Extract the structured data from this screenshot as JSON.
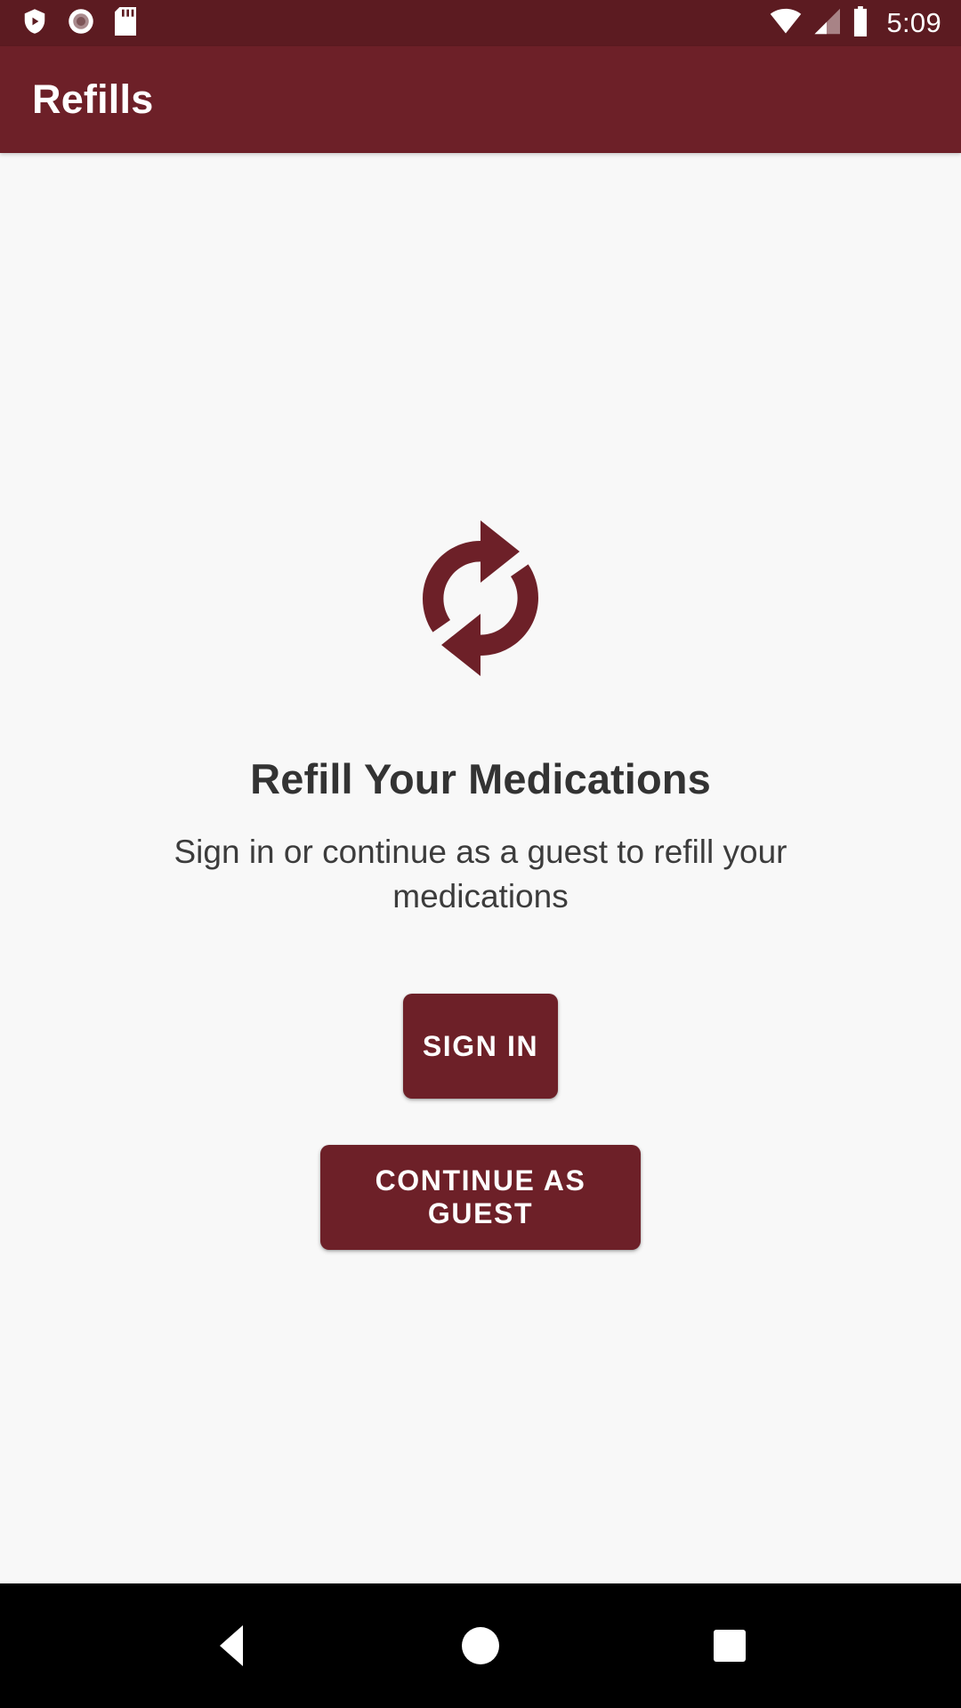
{
  "status_bar": {
    "time": "5:09",
    "left_icons": [
      {
        "name": "play-protect-shield-icon",
        "glyph": "shield-play"
      },
      {
        "name": "record-circle-icon",
        "glyph": "record"
      },
      {
        "name": "sd-card-icon",
        "glyph": "sdcard"
      }
    ],
    "right_icons": [
      {
        "name": "wifi-icon",
        "glyph": "wifi-full"
      },
      {
        "name": "cellular-signal-icon",
        "glyph": "signal-partial"
      },
      {
        "name": "battery-icon",
        "glyph": "battery-full"
      }
    ],
    "background_color": "#5C1B21",
    "foreground_color": "#FFFFFF"
  },
  "app_bar": {
    "title": "Refills",
    "background_color": "#6D2028",
    "title_color": "#FFFFFF"
  },
  "main": {
    "hero_icon_name": "refresh-sync-icon",
    "hero_icon_color": "#6D2028",
    "headline": "Refill Your Medications",
    "subhead": "Sign in or continue as a guest to refill your medications",
    "background_color": "#F8F8F8",
    "headline_color": "#333333",
    "subhead_color": "#3C3C3C",
    "buttons": {
      "sign_in_label": "SIGN IN",
      "continue_guest_label": "CONTINUE AS GUEST",
      "button_color": "#6D2028",
      "button_text_color": "#FFFFFF"
    }
  },
  "nav_bar": {
    "background_color": "#000000",
    "items": [
      {
        "name": "nav-back-button",
        "glyph": "triangle-left"
      },
      {
        "name": "nav-home-button",
        "glyph": "circle"
      },
      {
        "name": "nav-recents-button",
        "glyph": "square"
      }
    ]
  }
}
